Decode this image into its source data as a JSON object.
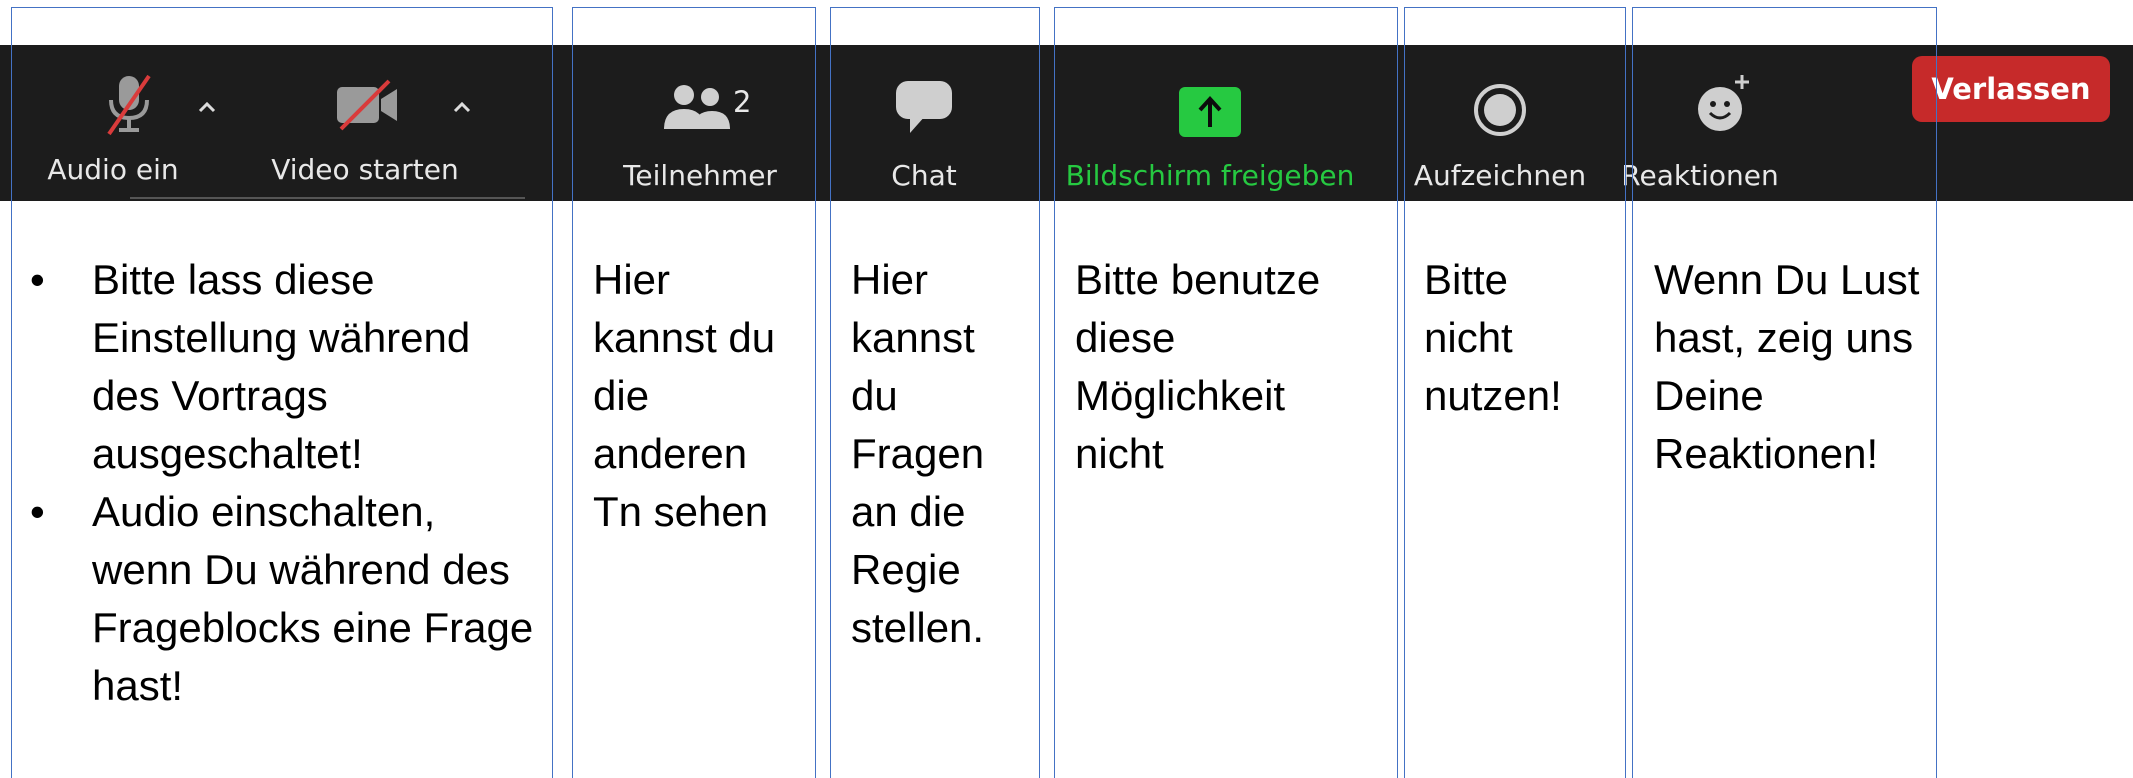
{
  "toolbar": {
    "audio_label": "Audio ein",
    "video_label": "Video starten",
    "participants_label": "Teilnehmer",
    "participants_count": "2",
    "chat_label": "Chat",
    "share_label": "Bildschirm freigeben",
    "record_label": "Aufzeichnen",
    "reactions_label": "Reaktionen",
    "leave_label": "Verlassen",
    "icons": {
      "audio": "microphone-muted-icon",
      "video": "video-camera-off-icon",
      "participants": "people-icon",
      "chat": "chat-bubble-icon",
      "share": "share-screen-icon",
      "record": "record-icon",
      "reactions": "emoji-add-icon"
    },
    "colors": {
      "background": "#1c1c1c",
      "share_green": "#26c941",
      "leave_red": "#c62a2a",
      "muted_slash": "#d93b3b"
    }
  },
  "notes": {
    "audio_video": [
      "Bitte lass diese Einstellung während des Vortrags ausgeschaltet!",
      "Audio einschalten, wenn Du während des Frageblocks eine Frage hast!"
    ],
    "participants": "Hier kannst du die anderen Tn sehen",
    "chat": "Hier kannst du Fragen an die Regie stellen.",
    "share": "Bitte benutze diese Möglichkeit nicht",
    "record": "Bitte nicht nutzen!",
    "reactions": "Wenn Du Lust hast, zeig uns Deine Reaktionen!"
  }
}
